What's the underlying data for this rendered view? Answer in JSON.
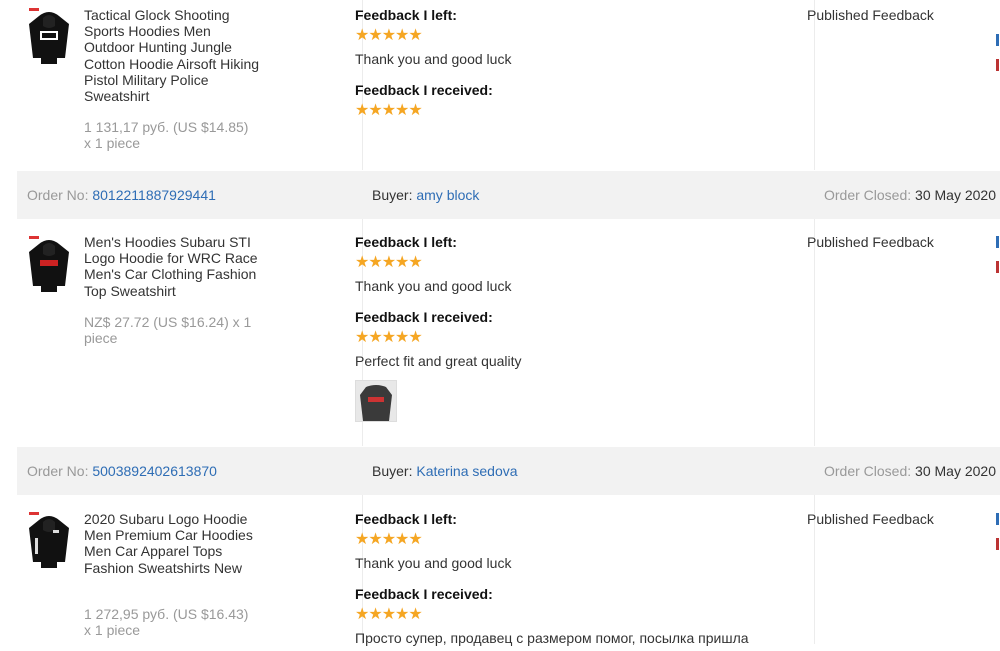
{
  "labels": {
    "order_no": "Order No:",
    "buyer": "Buyer:",
    "order_closed": "Order Closed:",
    "feedback_left": "Feedback I left:",
    "feedback_received": "Feedback I received:",
    "published": "Published Feedback",
    "stars": "★★★★★"
  },
  "orders": [
    {
      "product_title": "Tactical Glock Shooting Sports Hoodies Men Outdoor Hunting Jungle Cotton Hoodie Airsoft Hiking Pistol Military Police Sweatshirt",
      "price": "1 131,17 руб. (US $14.85)",
      "qty": "x 1 piece",
      "feedback_left_text": "Thank you and good luck",
      "feedback_received_text": "",
      "status": "Published Feedback"
    },
    {
      "order_no": "8012211887929441",
      "buyer": "amy block",
      "closed_date": "30 May 2020",
      "product_title": "Men's Hoodies Subaru STI Logo Hoodie for WRC Race Men's Car Clothing Fashion Top Sweatshirt",
      "price": "NZ$ 27.72 (US $16.24) x 1 piece",
      "feedback_left_text": "Thank you and good luck",
      "feedback_received_text": "Perfect fit and great quality",
      "status": "Published Feedback"
    },
    {
      "order_no": "5003892402613870",
      "buyer": "Katerina sedova",
      "closed_date": "30 May 2020",
      "product_title": "2020 Subaru Logo Hoodie Men Premium Car Hoodies Men Car Apparel Tops Fashion Sweatshirts New",
      "price": "1 272,95 руб. (US $16.43)",
      "qty": "x 1 piece",
      "feedback_left_text": "Thank you and good luck",
      "feedback_received_text": "Просто супер, продавец с размером помог, посылка пришла",
      "status": "Published Feedback"
    }
  ],
  "colors": {
    "star": "#f5a623",
    "link": "#2e6db5",
    "header_bg": "#f2f2f2"
  }
}
